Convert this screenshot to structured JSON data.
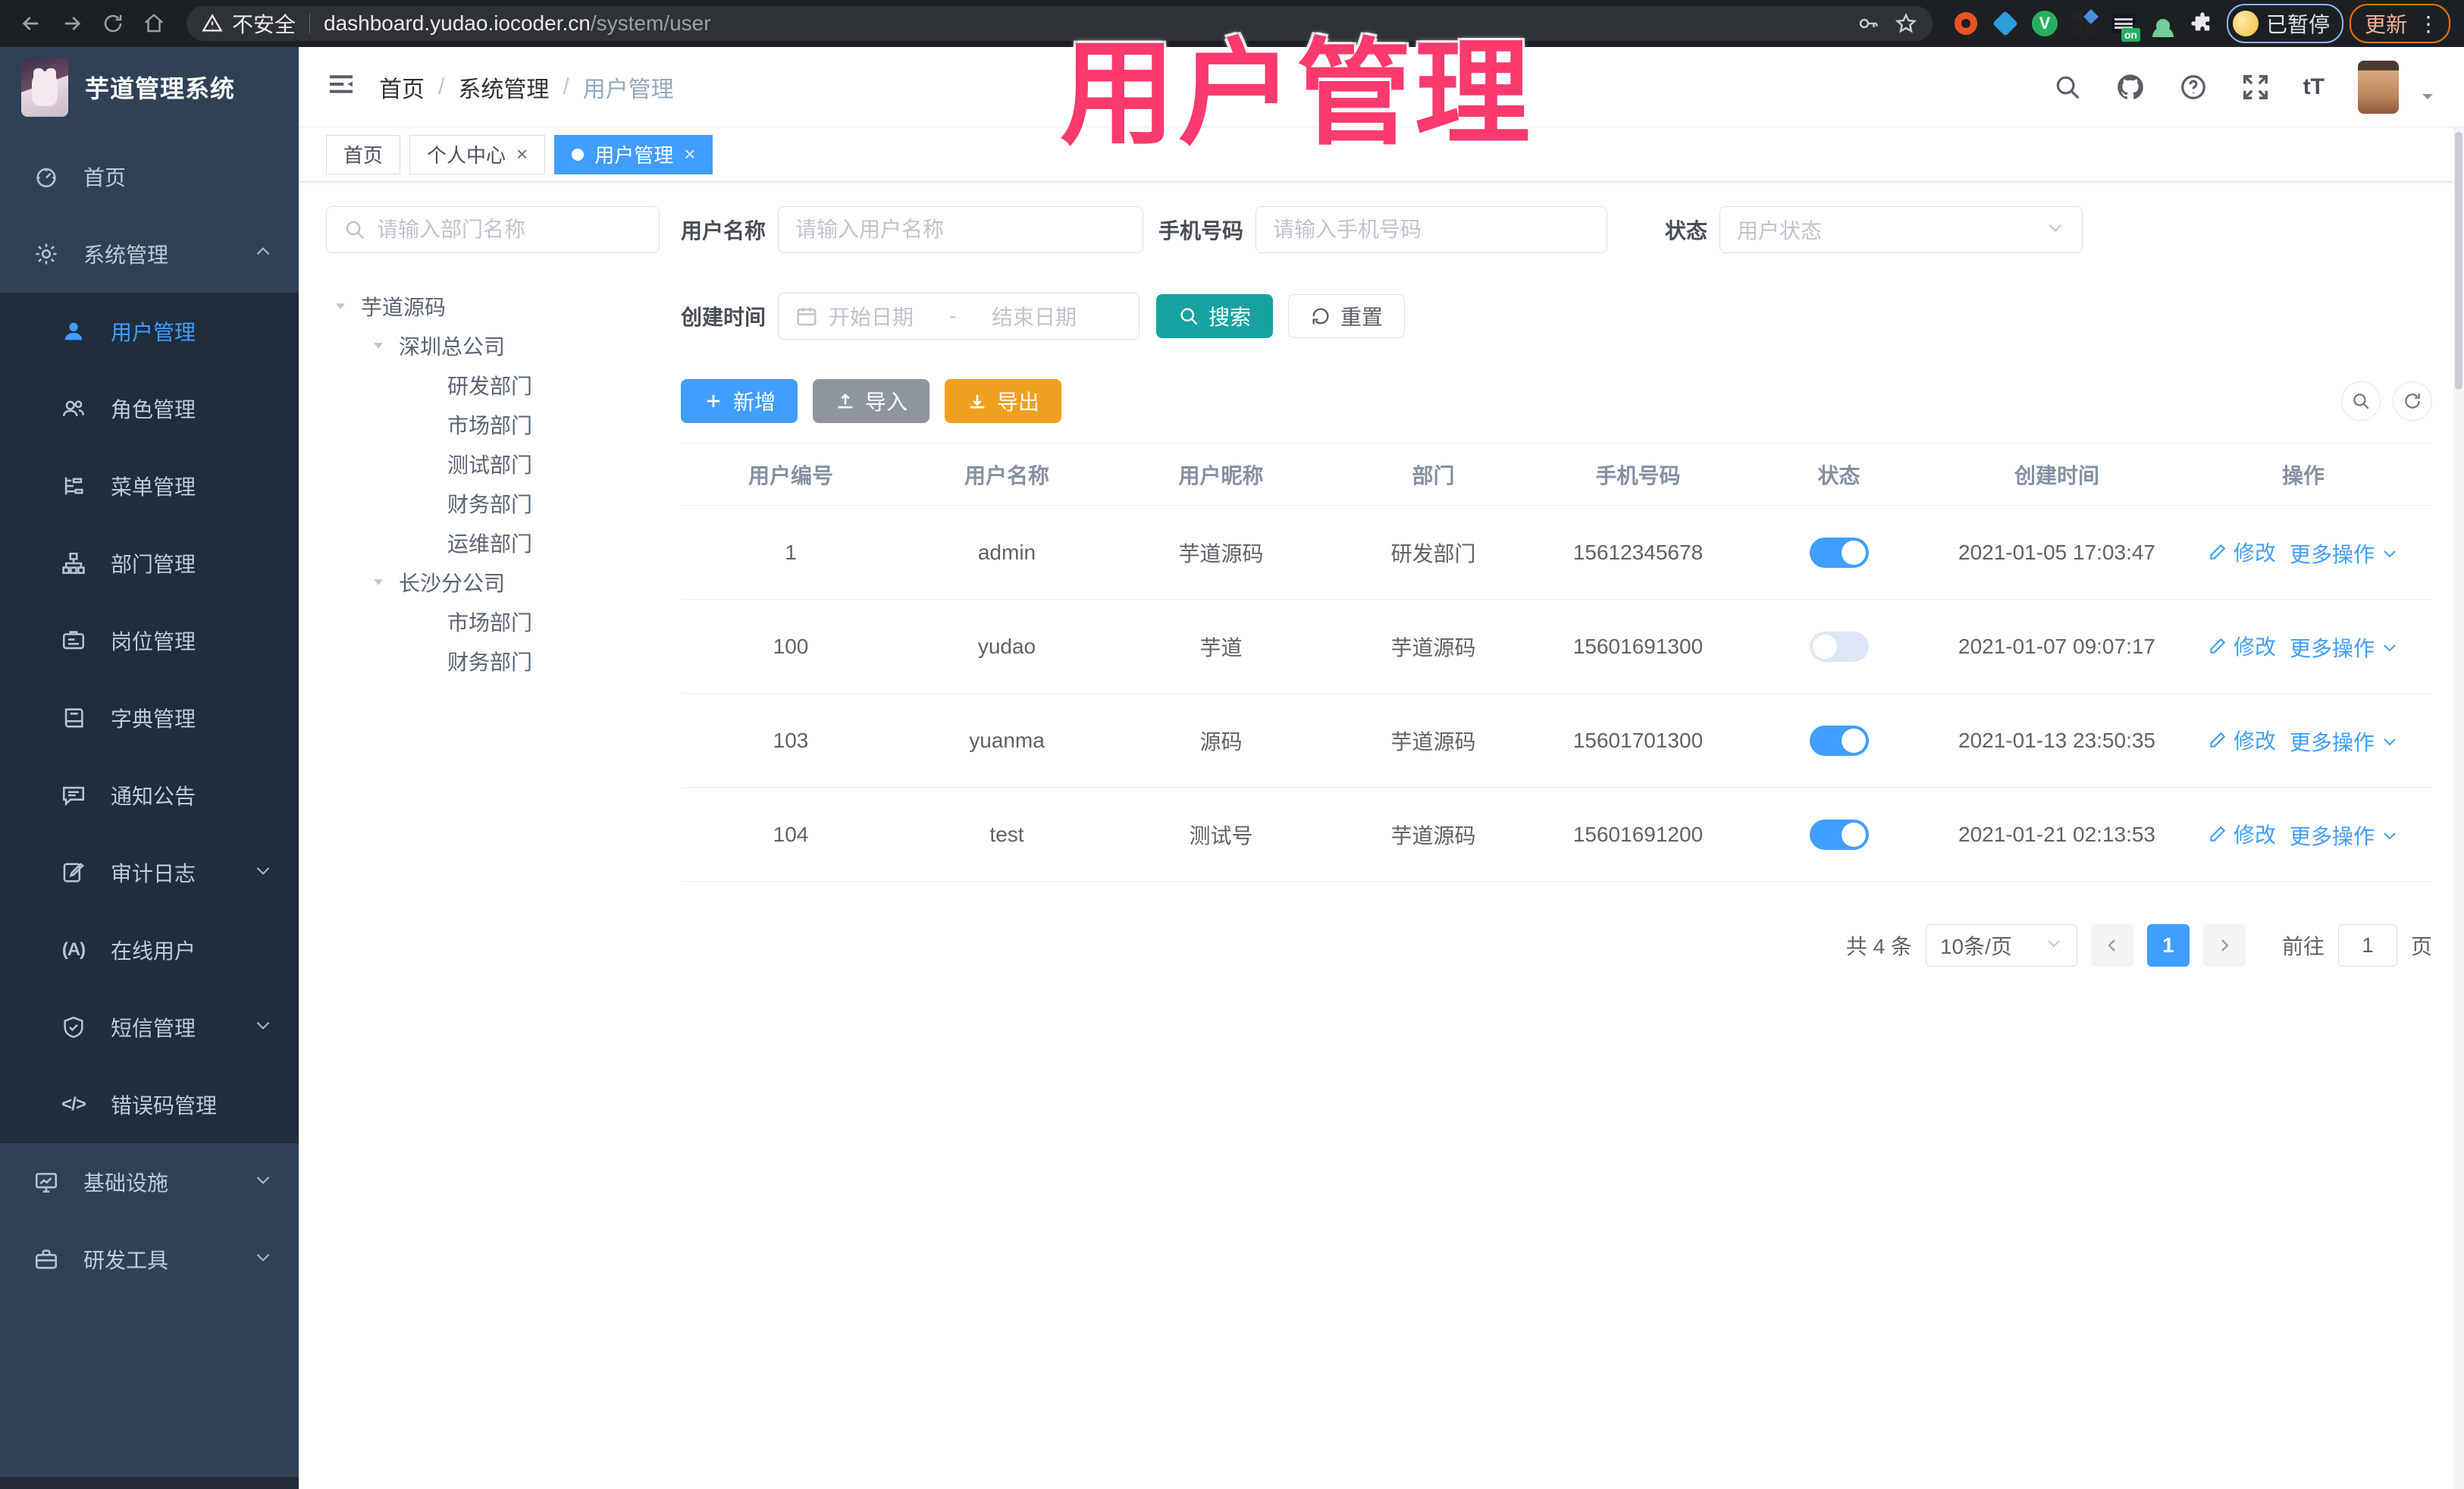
{
  "colors": {
    "primary": "#409eff",
    "search_teal": "#17a2a2",
    "export_orange": "#f0a020",
    "import_gray": "#8f959e",
    "overlay_pink": "#fb3a6e",
    "sidebar_bg": "#304156",
    "submenu_bg": "#1f2d3d"
  },
  "browser": {
    "security_label": "不安全",
    "url_host": "dashboard.yudao.iocoder.cn",
    "url_path": "/system/user",
    "nav_icons": [
      "back-arrow",
      "forward-arrow",
      "reload",
      "home"
    ],
    "pill_icons": [
      "key",
      "star"
    ],
    "extensions": [
      {
        "name": "ubuntu-ring",
        "color": "#e95420"
      },
      {
        "name": "blue-gem",
        "color": "#2d9cdb"
      },
      {
        "name": "green-v-circle",
        "color": "#27ae60"
      },
      {
        "name": "blue-squares",
        "color": "#4a90d9"
      },
      {
        "name": "list-on-badge",
        "color": "#27ae60",
        "badge": "on"
      },
      {
        "name": "green-person",
        "color": "#6fcf97"
      },
      {
        "name": "puzzle",
        "color": "#e8eaed"
      }
    ],
    "profile_badge": "已暂停",
    "update_button": "更新",
    "menu_dots": "⋮"
  },
  "overlay": {
    "title": "用户管理"
  },
  "app": {
    "logo_title": "芋道管理系统",
    "breadcrumb": [
      "首页",
      "系统管理",
      "用户管理"
    ],
    "header_icons": [
      "search",
      "github",
      "help",
      "fullscreen",
      "fontsize"
    ],
    "fontsize_glyph": "tT",
    "tabs": [
      {
        "label": "首页",
        "closable": false,
        "active": false
      },
      {
        "label": "个人中心",
        "closable": true,
        "active": false
      },
      {
        "label": "用户管理",
        "closable": true,
        "active": true
      }
    ]
  },
  "sidebar": {
    "items": [
      {
        "label": "首页",
        "icon": "dashboard",
        "type": "top"
      },
      {
        "label": "系统管理",
        "icon": "gear",
        "type": "top",
        "chevron": "up"
      },
      {
        "label": "用户管理",
        "icon": "user",
        "type": "sub",
        "active": true
      },
      {
        "label": "角色管理",
        "icon": "users",
        "type": "sub"
      },
      {
        "label": "菜单管理",
        "icon": "menu",
        "type": "sub"
      },
      {
        "label": "部门管理",
        "icon": "dept",
        "type": "sub"
      },
      {
        "label": "岗位管理",
        "icon": "post",
        "type": "sub"
      },
      {
        "label": "字典管理",
        "icon": "dict",
        "type": "sub"
      },
      {
        "label": "通知公告",
        "icon": "notice",
        "type": "sub"
      },
      {
        "label": "审计日志",
        "icon": "log",
        "type": "sub",
        "chevron": "down"
      },
      {
        "label": "在线用户",
        "icon": "online",
        "type": "sub"
      },
      {
        "label": "短信管理",
        "icon": "sms",
        "type": "sub",
        "chevron": "down"
      },
      {
        "label": "错误码管理",
        "icon": "code",
        "type": "sub"
      },
      {
        "label": "基础设施",
        "icon": "monitor",
        "type": "top",
        "chevron": "down"
      },
      {
        "label": "研发工具",
        "icon": "tool",
        "type": "top",
        "chevron": "down"
      }
    ],
    "glyphs": {
      "online": "(A)",
      "code": "</>"
    }
  },
  "tree": {
    "search_placeholder": "请输入部门名称",
    "nodes": [
      {
        "label": "芋道源码",
        "level": 1,
        "expandable": true
      },
      {
        "label": "深圳总公司",
        "level": 2,
        "expandable": true
      },
      {
        "label": "研发部门",
        "level": 3
      },
      {
        "label": "市场部门",
        "level": 3
      },
      {
        "label": "测试部门",
        "level": 3
      },
      {
        "label": "财务部门",
        "level": 3
      },
      {
        "label": "运维部门",
        "level": 3
      },
      {
        "label": "长沙分公司",
        "level": 2,
        "expandable": true
      },
      {
        "label": "市场部门",
        "level": 3
      },
      {
        "label": "财务部门",
        "level": 3
      }
    ]
  },
  "filters": {
    "username_label": "用户名称",
    "username_placeholder": "请输入用户名称",
    "mobile_label": "手机号码",
    "mobile_placeholder": "请输入手机号码",
    "status_label": "状态",
    "status_placeholder": "用户状态",
    "create_time_label": "创建时间",
    "date_start_placeholder": "开始日期",
    "date_separator": "-",
    "date_end_placeholder": "结束日期",
    "search_button": "搜索",
    "reset_button": "重置"
  },
  "toolbar": {
    "add_label": "新增",
    "import_label": "导入",
    "export_label": "导出"
  },
  "table": {
    "columns": [
      "用户编号",
      "用户名称",
      "用户昵称",
      "部门",
      "手机号码",
      "状态",
      "创建时间",
      "操作"
    ],
    "rows": [
      {
        "id": "1",
        "username": "admin",
        "nickname": "芋道源码",
        "dept": "研发部门",
        "mobile": "15612345678",
        "status": true,
        "create_time": "2021-01-05 17:03:47"
      },
      {
        "id": "100",
        "username": "yudao",
        "nickname": "芋道",
        "dept": "芋道源码",
        "mobile": "15601691300",
        "status": false,
        "create_time": "2021-01-07 09:07:17"
      },
      {
        "id": "103",
        "username": "yuanma",
        "nickname": "源码",
        "dept": "芋道源码",
        "mobile": "15601701300",
        "status": true,
        "create_time": "2021-01-13 23:50:35"
      },
      {
        "id": "104",
        "username": "test",
        "nickname": "测试号",
        "dept": "芋道源码",
        "mobile": "15601691200",
        "status": true,
        "create_time": "2021-01-21 02:13:53"
      }
    ],
    "actions": {
      "edit": "修改",
      "more": "更多操作"
    }
  },
  "pagination": {
    "total_text": "共 4 条",
    "page_size": "10条/页",
    "current_page": "1",
    "goto_label": "前往",
    "goto_value": "1",
    "page_label": "页"
  }
}
